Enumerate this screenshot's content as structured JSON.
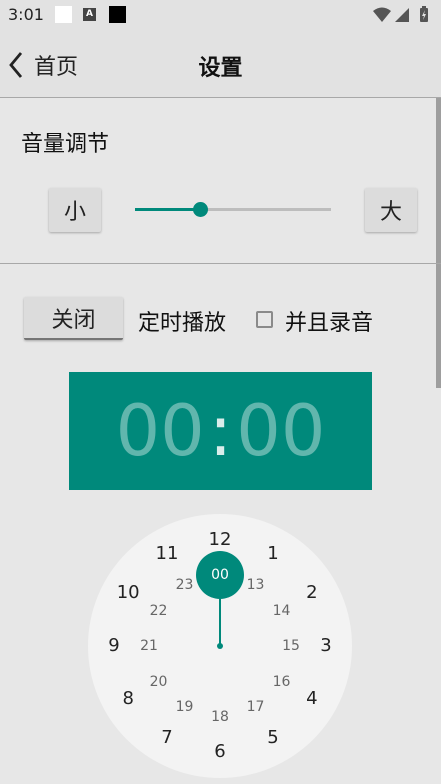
{
  "status_bar": {
    "time": "3:01",
    "icons": [
      "white-square-icon",
      "a-badge-icon",
      "black-square-icon",
      "wifi-icon",
      "signal-icon",
      "battery-icon"
    ],
    "a_badge_text": "A"
  },
  "app_bar": {
    "back_label": "首页",
    "title": "设置"
  },
  "volume": {
    "title": "音量调节",
    "decrease_label": "小",
    "increase_label": "大",
    "level": 0.33
  },
  "timer": {
    "toggle_label": "关闭",
    "timed_play_label": "定时播放",
    "record_label": "并且录音",
    "record_checked": false
  },
  "time_picker": {
    "hour": "00",
    "separator": ":",
    "minute": "00",
    "selected": "00",
    "outer_numbers": [
      "12",
      "1",
      "2",
      "3",
      "4",
      "5",
      "6",
      "7",
      "8",
      "9",
      "10",
      "11"
    ],
    "inner_numbers": [
      "13",
      "14",
      "15",
      "16",
      "17",
      "18",
      "19",
      "20",
      "21",
      "22",
      "23"
    ]
  },
  "colors": {
    "accent": "#00897b",
    "background": "#e7e7e7",
    "clock_face": "#f3f3f3"
  }
}
